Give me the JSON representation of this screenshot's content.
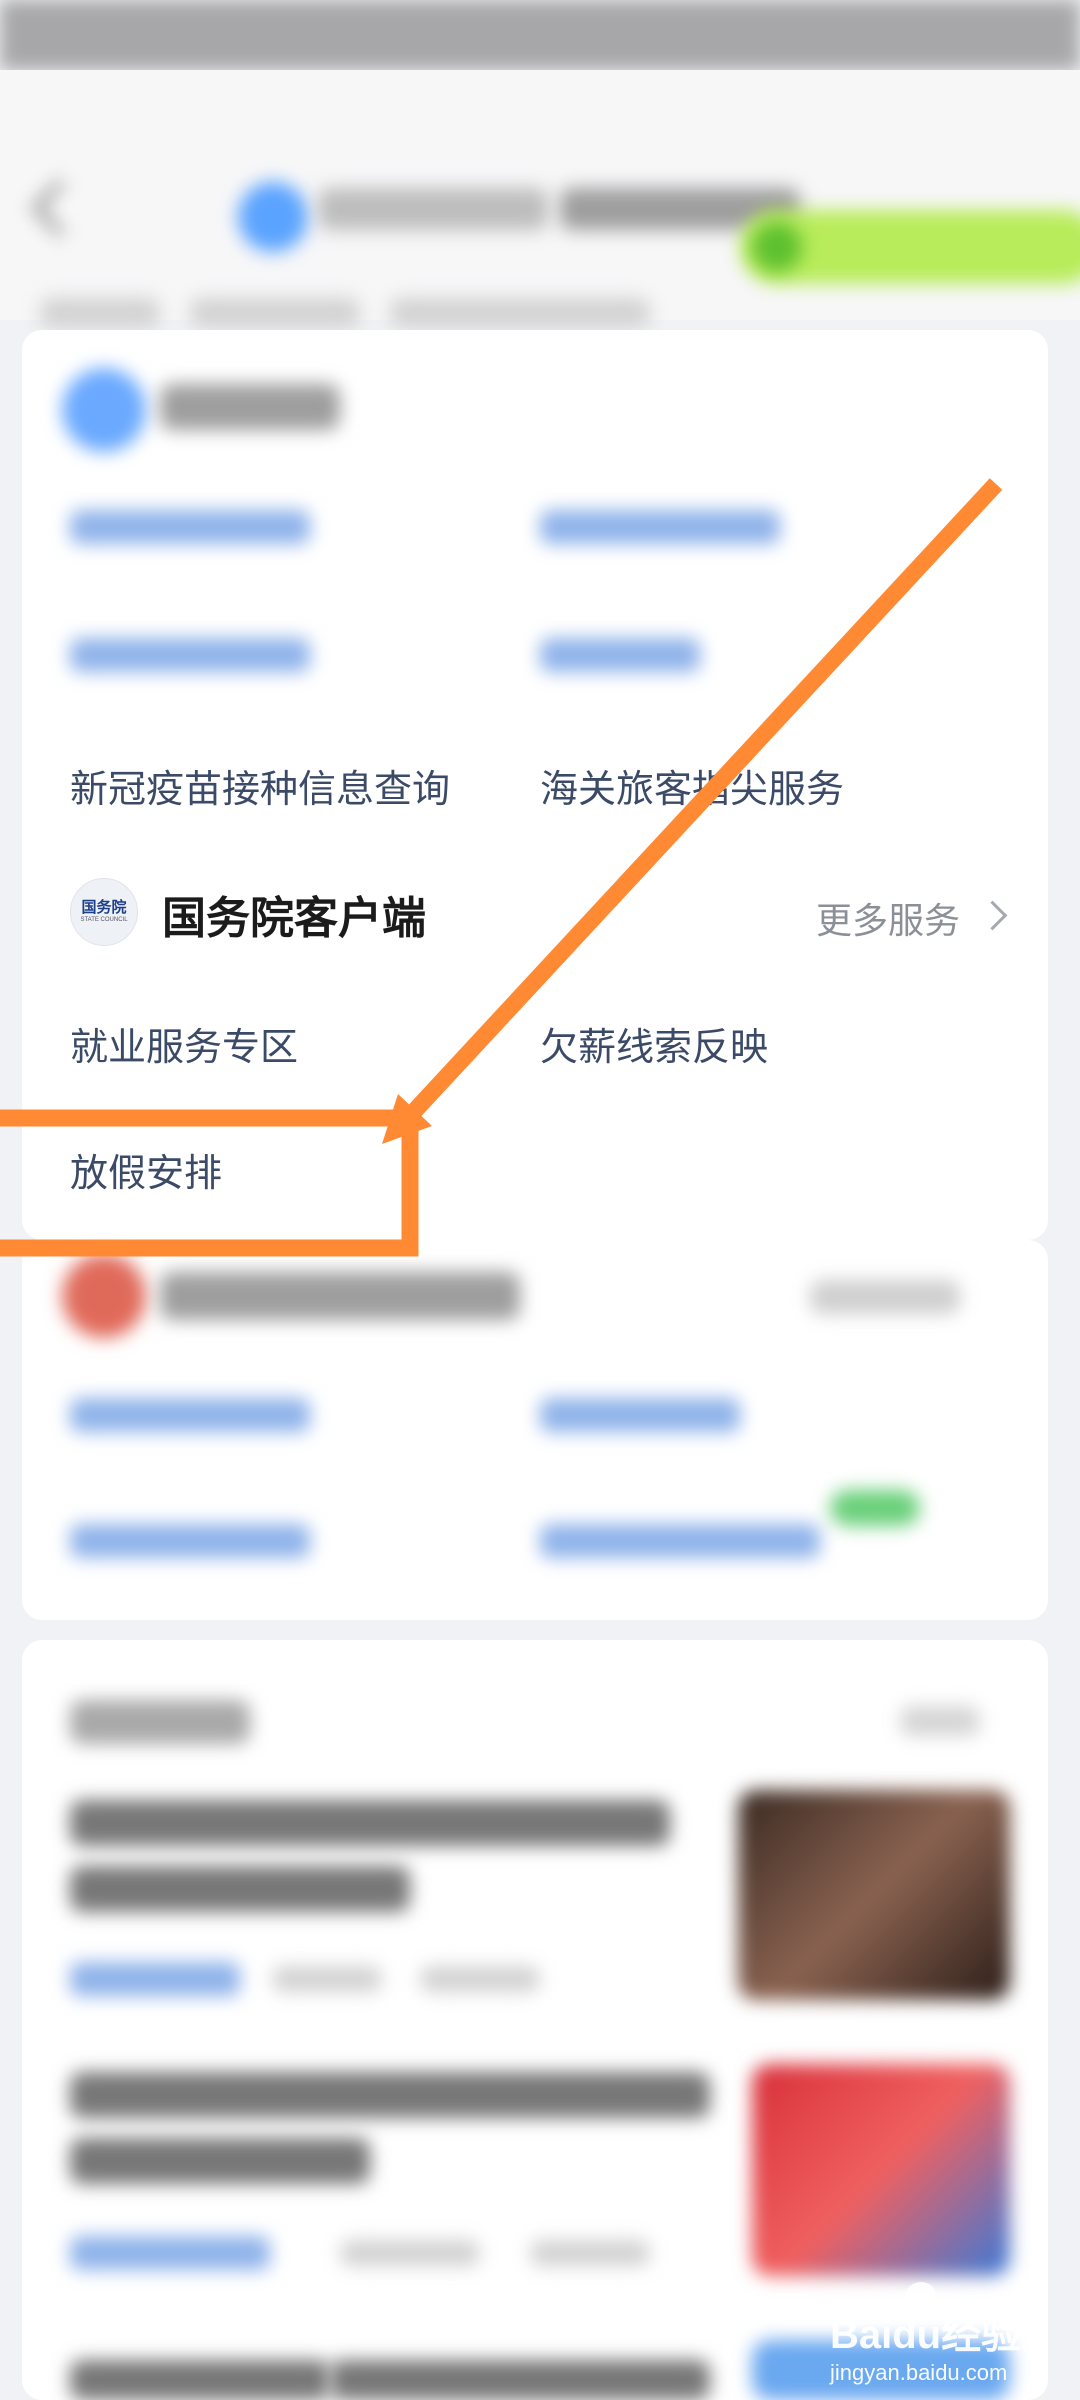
{
  "status_bar": {},
  "header": {
    "back_icon": "chevron-left-icon"
  },
  "visible_services": {
    "row_top": [
      {
        "label": "新冠疫苗接种信息查询"
      },
      {
        "label": "海关旅客指尖服务"
      }
    ]
  },
  "state_council_section": {
    "logo_text": "国务院",
    "logo_subtext": "STATE COUNCIL",
    "title": "国务院客户端",
    "more_label": "更多服务",
    "items": [
      {
        "label": "就业服务专区"
      },
      {
        "label": "欠薪线索反映"
      },
      {
        "label": "放假安排"
      }
    ]
  },
  "annotation": {
    "color": "#ff8a33"
  },
  "watermark": {
    "brand": "Baidu经验",
    "url": "jingyan.baidu.com"
  }
}
